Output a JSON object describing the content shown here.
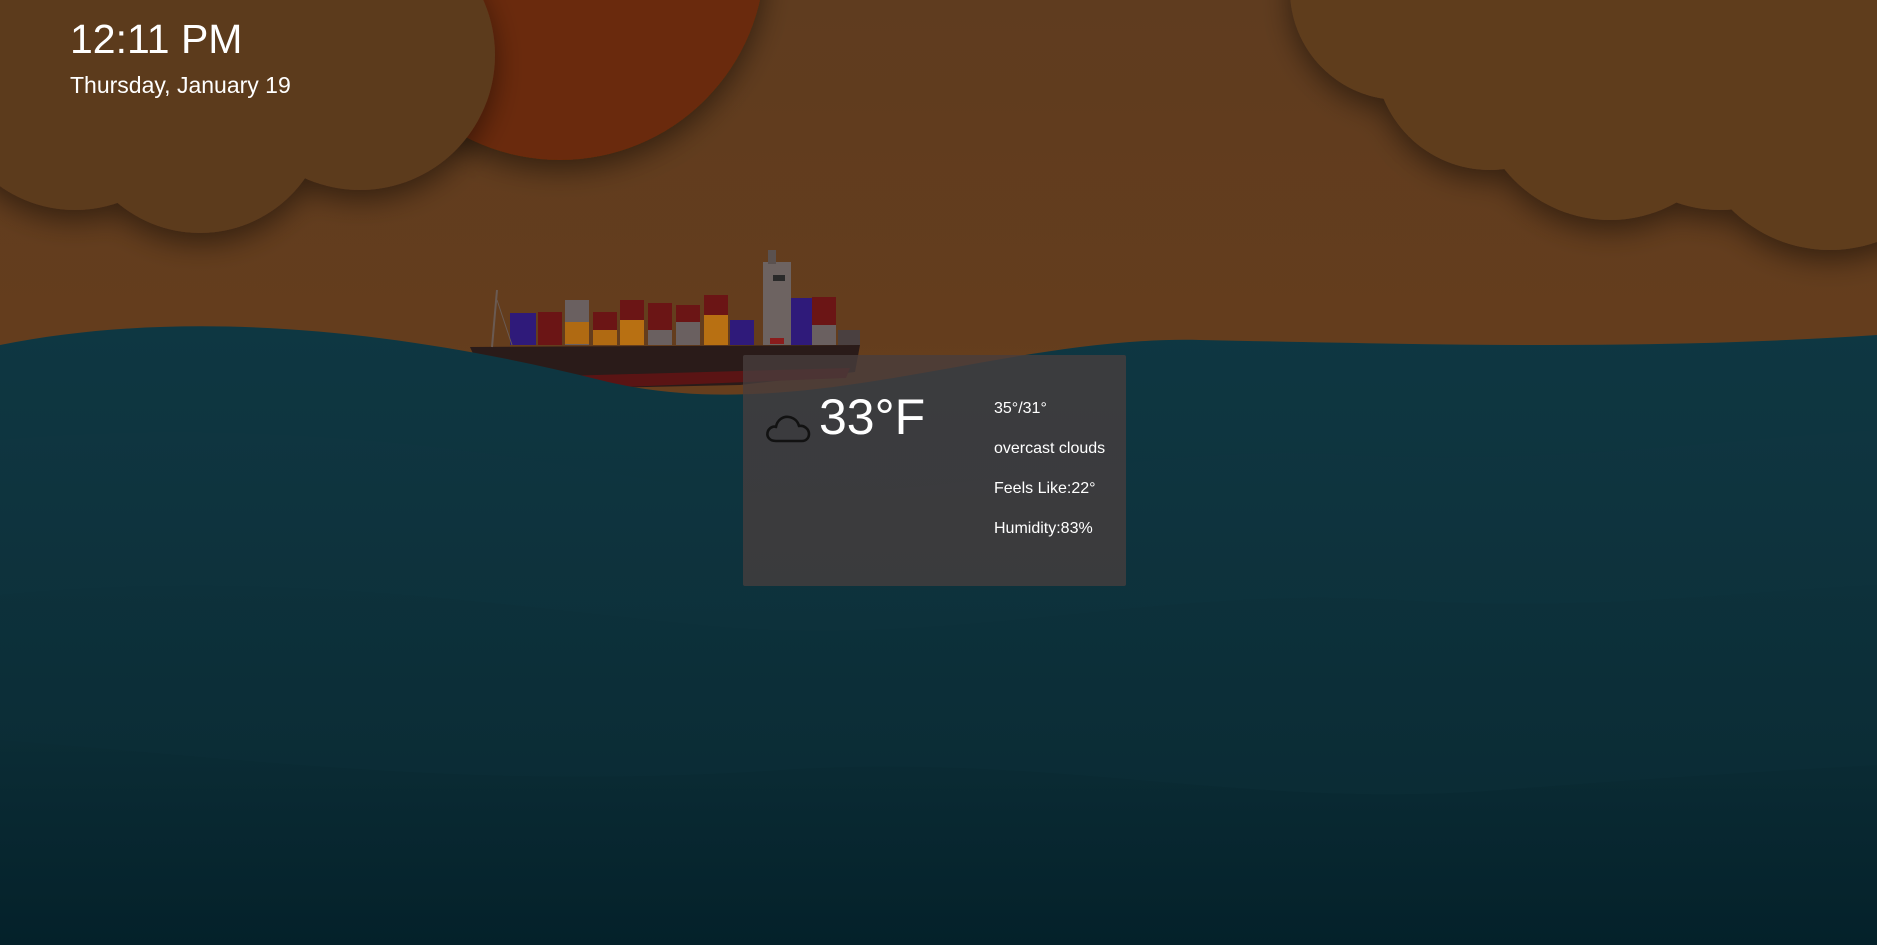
{
  "clock": {
    "time": "12:11 PM",
    "date": "Thursday, January 19"
  },
  "weather": {
    "icon": "cloud-icon",
    "temperature": "33°F",
    "high_low": "35°/31°",
    "description": "overcast clouds",
    "feels_like": "Feels Like:22°",
    "humidity": "Humidity:83%"
  },
  "colors": {
    "sky": "#5e3a1c",
    "sun": "#6b2a08",
    "sea": "#0b2f3a",
    "card": "#483e3e",
    "text": "#ffffff"
  }
}
